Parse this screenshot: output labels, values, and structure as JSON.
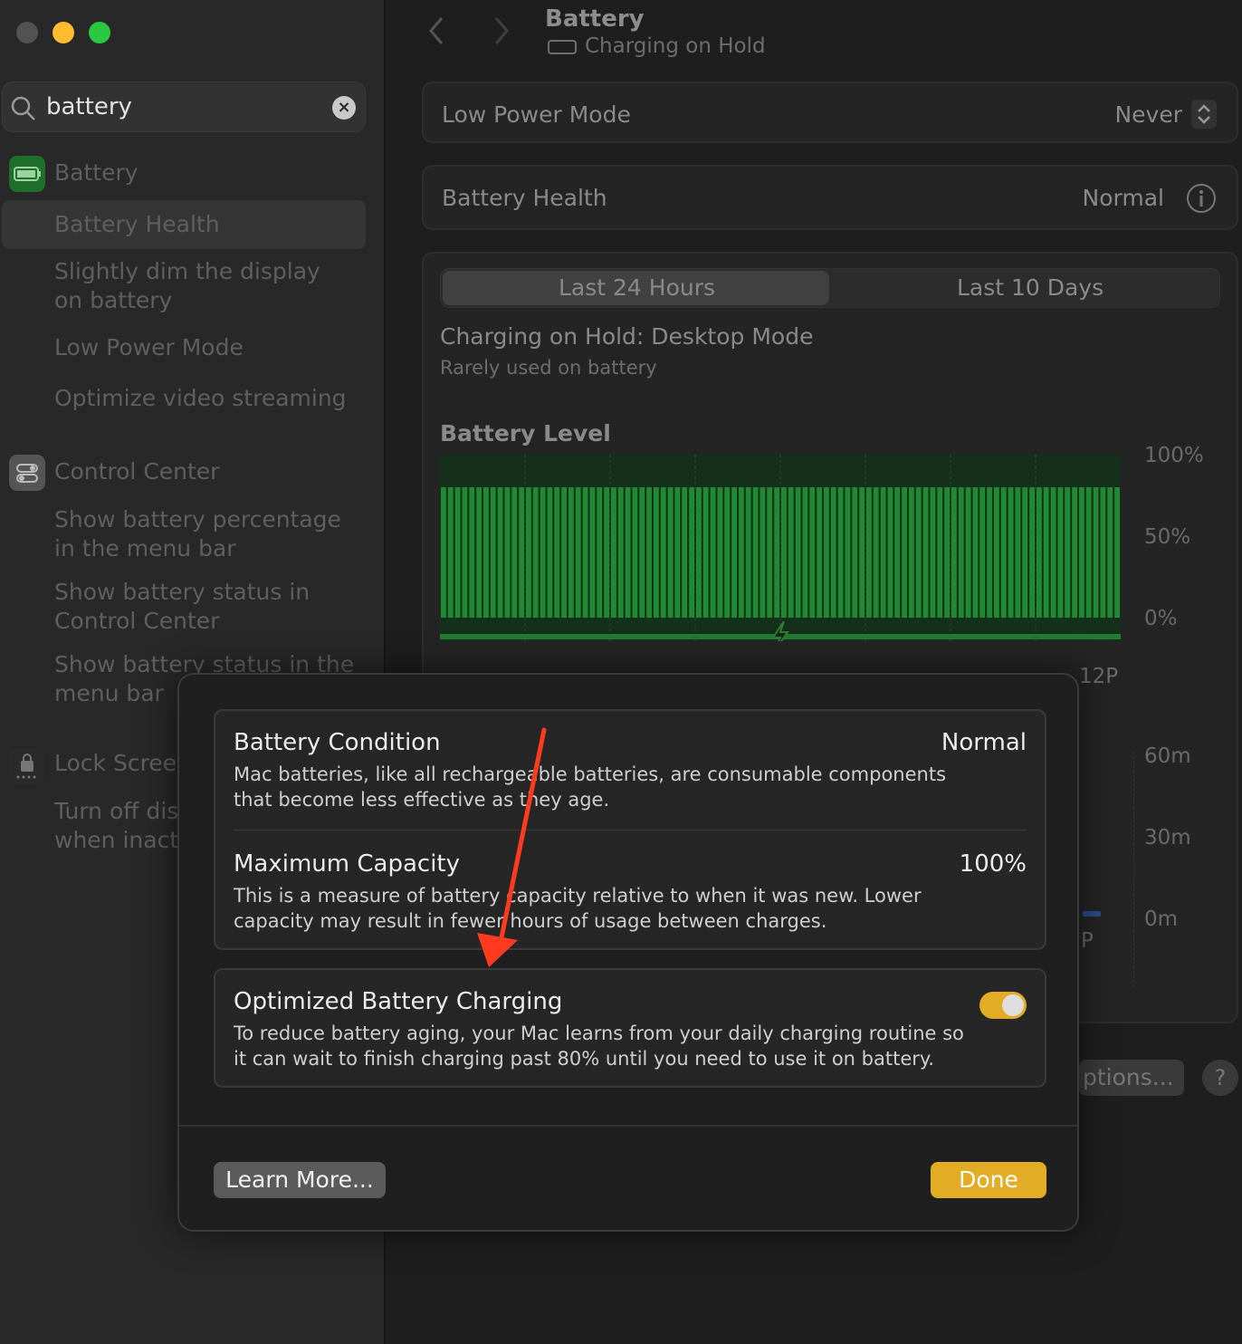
{
  "window": {
    "title": "Battery",
    "subtitle": "Charging on Hold"
  },
  "search": {
    "value": "battery"
  },
  "sidebar": {
    "categories": [
      {
        "label": "Battery",
        "items": [
          "Battery Health",
          "Slightly dim the display on battery",
          "Low Power Mode",
          "Optimize video streaming"
        ]
      },
      {
        "label": "Control Center",
        "items": [
          "Show battery percentage in the menu bar",
          "Show battery status in Control Center",
          "Show battery status in the menu bar"
        ]
      },
      {
        "label": "Lock Scree",
        "items": [
          "Turn off dis when inact"
        ]
      }
    ],
    "selected": "Battery Health"
  },
  "main": {
    "low_power": {
      "label": "Low Power Mode",
      "value": "Never"
    },
    "health": {
      "label": "Battery Health",
      "value": "Normal"
    },
    "tabs": [
      "Last 24 Hours",
      "Last 10 Days"
    ],
    "active_tab": "Last 24 Hours",
    "status_title": "Charging on Hold: Desktop Mode",
    "status_sub": "Rarely used on battery",
    "level_title": "Battery Level",
    "level_axis": [
      "100%",
      "50%",
      "0%"
    ],
    "usage_axis": [
      "60m",
      "30m",
      "0m"
    ],
    "partial_label_1": "12P",
    "partial_label_2": "P",
    "options_button": "ptions...",
    "help_button": "?"
  },
  "modal": {
    "condition": {
      "title": "Battery Condition",
      "value": "Normal",
      "desc": "Mac batteries, like all rechargeable batteries, are consumable components that become less effective as they age."
    },
    "capacity": {
      "title": "Maximum Capacity",
      "value": "100%",
      "desc": "This is a measure of battery capacity relative to when it was new. Lower capacity may result in fewer hours of usage between charges."
    },
    "optimized": {
      "title": "Optimized Battery Charging",
      "enabled": true,
      "desc": "To reduce battery aging, your Mac learns from your daily charging routine so it can wait to finish charging past 80% until you need to use it on battery."
    },
    "learn_more": "Learn More...",
    "done": "Done"
  },
  "colors": {
    "accent": "#e3ac25",
    "battery_green": "#1f8a33",
    "annotation_arrow": "#ff3b1f"
  }
}
